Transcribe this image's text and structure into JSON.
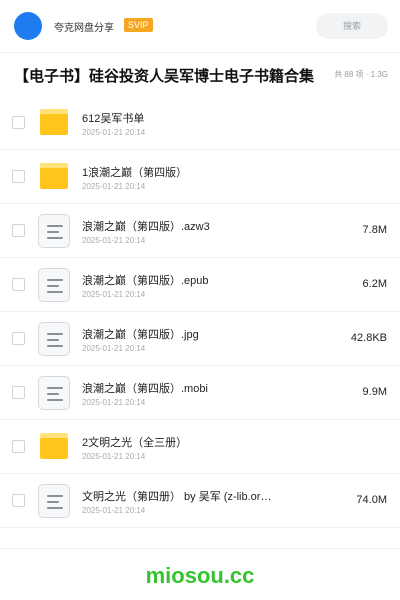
{
  "header": {
    "brand": "夸克网盘分享",
    "badge": "SVIP",
    "search_placeholder": "搜索"
  },
  "share": {
    "title": "【电子书】硅谷投资人吴军博士电子书籍合集",
    "meta": "共 88 项 · 1.3G"
  },
  "files": [
    {
      "kind": "folder",
      "name": "612吴军书单",
      "date": "2025-01-21 20:14",
      "size": ""
    },
    {
      "kind": "folder",
      "name": "1浪潮之巅（第四版）",
      "date": "2025-01-21 20:14",
      "size": ""
    },
    {
      "kind": "file",
      "name": "浪潮之巅（第四版）.azw3",
      "date": "2025-01-21 20:14",
      "size": "7.8M"
    },
    {
      "kind": "file",
      "name": "浪潮之巅（第四版）.epub",
      "date": "2025-01-21 20:14",
      "size": "6.2M"
    },
    {
      "kind": "file",
      "name": "浪潮之巅（第四版）.jpg",
      "date": "2025-01-21 20:14",
      "size": "42.8KB"
    },
    {
      "kind": "file",
      "name": "浪潮之巅（第四版）.mobi",
      "date": "2025-01-21 20:14",
      "size": "9.9M"
    },
    {
      "kind": "folder",
      "name": "2文明之光（全三册）",
      "date": "2025-01-21 20:14",
      "size": ""
    },
    {
      "kind": "file",
      "name": "文明之光（第四册） by 吴军 (z-lib.or…",
      "date": "2025-01-21 20:14",
      "size": "74.0M"
    }
  ],
  "watermark": "miosou.cc",
  "colors": {
    "avatar": "#1e7cf0",
    "svip_badge": "#f5a623",
    "folder": "#ffc51c",
    "watermark": "#35c32f"
  },
  "icons": {
    "folder": "folder-icon",
    "file": "document-icon"
  }
}
